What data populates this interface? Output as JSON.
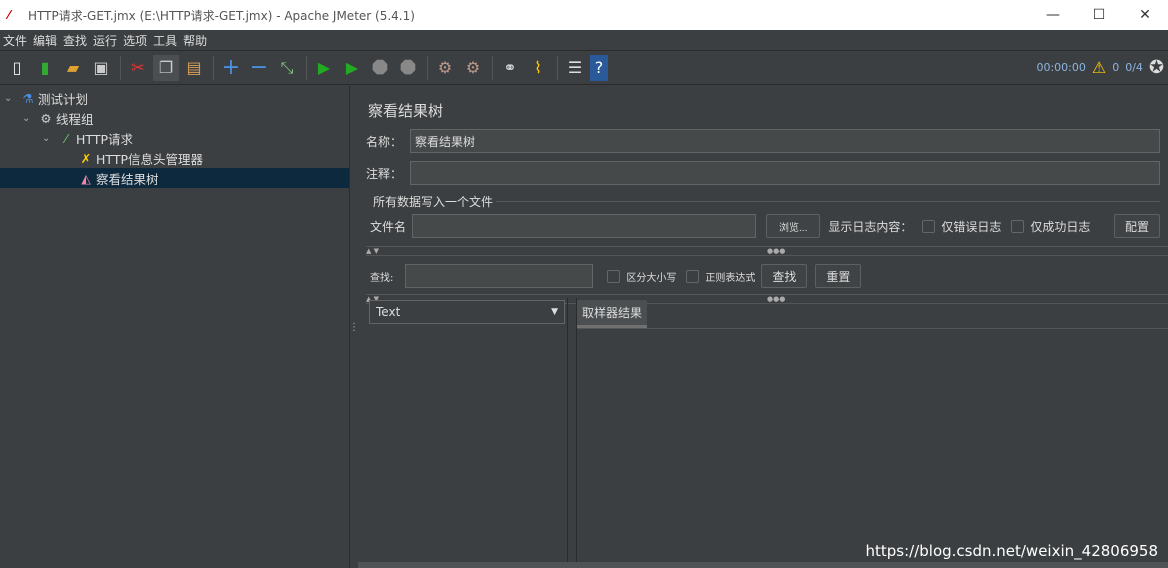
{
  "window": {
    "title": "HTTP请求-GET.jmx (E:\\HTTP请求-GET.jmx) - Apache JMeter (5.4.1)",
    "min": "—",
    "max": "☐",
    "close": "✕"
  },
  "menu": [
    "文件",
    "编辑",
    "查找",
    "运行",
    "选项",
    "工具",
    "帮助"
  ],
  "status": {
    "timer": "00:00:00",
    "warnings": "0",
    "threads": "0/4"
  },
  "tree": [
    {
      "label": "测试计划",
      "icon": "flask-icon"
    },
    {
      "label": "线程组",
      "icon": "gear-icon"
    },
    {
      "label": "HTTP请求",
      "icon": "pipette-icon"
    },
    {
      "label": "HTTP信息头管理器",
      "icon": "tools-icon"
    },
    {
      "label": "察看结果树",
      "icon": "chart-icon",
      "selected": true
    }
  ],
  "panel": {
    "title": "察看结果树",
    "name_label": "名称：",
    "name_value": "察看结果树",
    "comment_label": "注释：",
    "comment_value": "",
    "file_group": "所有数据写入一个文件",
    "filename_label": "文件名",
    "browse": "浏览...",
    "log_label": "显示日志内容：",
    "errors_only": "仅错误日志",
    "success_only": "仅成功日志",
    "configure": "配置",
    "search_label": "查找:",
    "case_sensitive": "区分大小写",
    "regex": "正则表达式",
    "find": "查找",
    "reset": "重置",
    "renderer": "Text",
    "tab": "取样器结果"
  },
  "watermark": "https://blog.csdn.net/weixin_42806958"
}
